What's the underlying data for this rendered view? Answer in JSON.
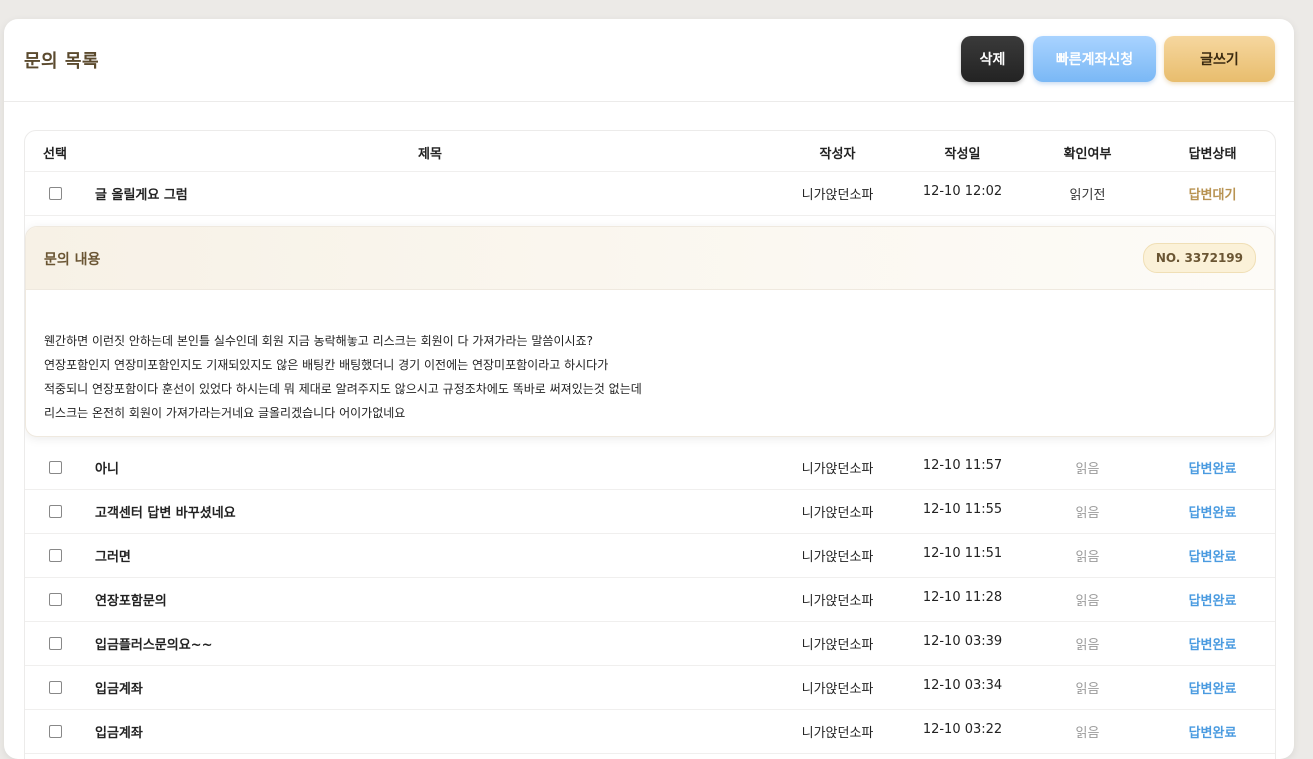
{
  "header": {
    "title": "문의 목록",
    "delete_label": "삭제",
    "fast_account_label": "빠른계좌신청",
    "write_label": "글쓰기"
  },
  "columns": {
    "select": "선택",
    "title": "제목",
    "author": "작성자",
    "date": "작성일",
    "read": "확인여부",
    "status": "답변상태"
  },
  "first_row": {
    "title": "글 올릴게요 그럼",
    "author": "니가앉던소파",
    "date": "12-10 12:02",
    "read": "읽기전",
    "status": "답변대기"
  },
  "detail": {
    "title": "문의 내용",
    "number": "NO. 3372199",
    "lines": [
      "웬간하면 이런짓 안하는데 본인틀 실수인데 회원 지금 농락해놓고 리스크는 회원이 다 가져가라는 말씀이시죠?",
      "연장포함인지 연장미포함인지도 기재되있지도 않은 배팅칸 배팅했더니 경기 이전에는 연장미포함이라고 하시다가",
      "적중되니 연장포함이다 훈선이 있었다 하시는데 뭐 제대로 알려주지도 않으시고 규정조차에도 똑바로 써져있는것 없는데",
      "리스크는 온전히 회원이 가져가라는거네요 글올리겠습니다 어이가없네요"
    ]
  },
  "rows": [
    {
      "title": "아니",
      "author": "니가앉던소파",
      "date": "12-10 11:57",
      "read": "읽음",
      "status": "답변완료"
    },
    {
      "title": "고객센터 답변 바꾸셨네요",
      "author": "니가앉던소파",
      "date": "12-10 11:55",
      "read": "읽음",
      "status": "답변완료"
    },
    {
      "title": "그러면",
      "author": "니가앉던소파",
      "date": "12-10 11:51",
      "read": "읽음",
      "status": "답변완료"
    },
    {
      "title": "연장포함문의",
      "author": "니가앉던소파",
      "date": "12-10 11:28",
      "read": "읽음",
      "status": "답변완료"
    },
    {
      "title": "입금플러스문의요~~",
      "author": "니가앉던소파",
      "date": "12-10 03:39",
      "read": "읽음",
      "status": "답변완료"
    },
    {
      "title": "입금계좌",
      "author": "니가앉던소파",
      "date": "12-10 03:34",
      "read": "읽음",
      "status": "답변완료"
    },
    {
      "title": "입금계좌",
      "author": "니가앉던소파",
      "date": "12-10 03:22",
      "read": "읽음",
      "status": "답변완료"
    }
  ],
  "colors": {
    "accent_gold": "#e8bd6d",
    "accent_blue": "#7ab8f5",
    "status_done": "#4a9be0",
    "status_waiting": "#b89352"
  }
}
